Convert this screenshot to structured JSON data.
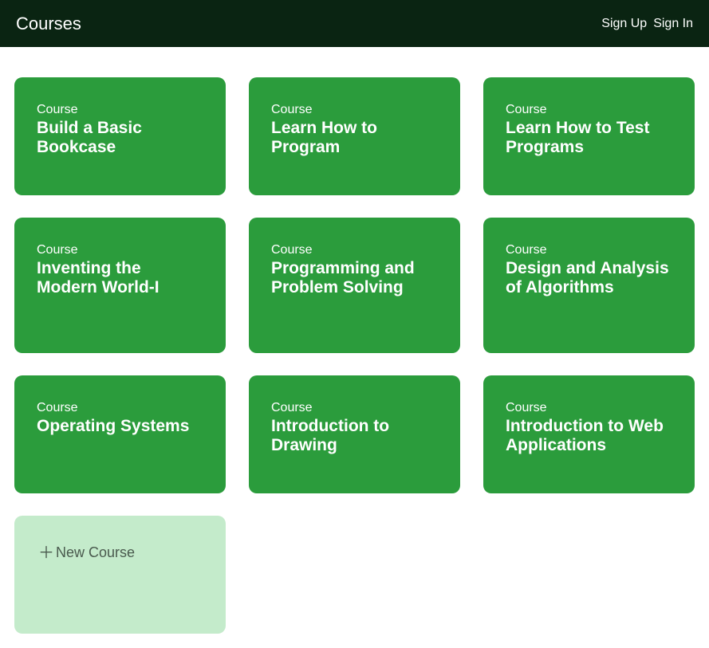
{
  "navbar": {
    "brand": "Courses",
    "signup": "Sign Up",
    "signin": "Sign In"
  },
  "courses": [
    {
      "label": "Course",
      "title": "Build a Basic Bookcase"
    },
    {
      "label": "Course",
      "title": "Learn How to Program"
    },
    {
      "label": "Course",
      "title": "Learn How to Test Programs"
    },
    {
      "label": "Course",
      "title": "Inventing the Modern World-I"
    },
    {
      "label": "Course",
      "title": "Programming and Problem Solving"
    },
    {
      "label": "Course",
      "title": "Design and Analysis of Algorithms"
    },
    {
      "label": "Course",
      "title": "Operating Systems"
    },
    {
      "label": "Course",
      "title": "Introduction to Drawing"
    },
    {
      "label": "Course",
      "title": "Introduction to Web Applications"
    }
  ],
  "new_course": {
    "label": "New Course"
  }
}
